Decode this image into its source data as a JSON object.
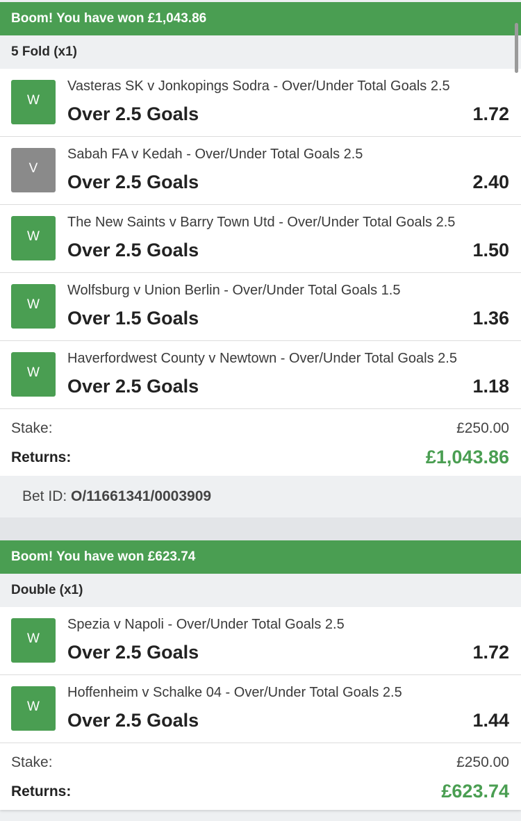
{
  "bets": [
    {
      "banner": "Boom! You have won £1,043.86",
      "type": "5 Fold (x1)",
      "legs": [
        {
          "result": "W",
          "market": "Vasteras SK v Jonkopings Sodra - Over/Under Total Goals 2.5",
          "selection": "Over 2.5 Goals",
          "odds": "1.72"
        },
        {
          "result": "V",
          "market": "Sabah FA v Kedah - Over/Under Total Goals 2.5",
          "selection": "Over 2.5 Goals",
          "odds": "2.40"
        },
        {
          "result": "W",
          "market": "The New Saints v Barry Town Utd - Over/Under Total Goals 2.5",
          "selection": "Over 2.5 Goals",
          "odds": "1.50"
        },
        {
          "result": "W",
          "market": "Wolfsburg v Union Berlin - Over/Under Total Goals 1.5",
          "selection": "Over 1.5 Goals",
          "odds": "1.36"
        },
        {
          "result": "W",
          "market": "Haverfordwest County v Newtown - Over/Under Total Goals 2.5",
          "selection": "Over 2.5 Goals",
          "odds": "1.18"
        }
      ],
      "stake_label": "Stake:",
      "stake": "£250.00",
      "returns_label": "Returns:",
      "returns": "£1,043.86",
      "bet_id_label": "Bet ID:",
      "bet_id": "O/11661341/0003909"
    },
    {
      "banner": "Boom! You have won £623.74",
      "type": "Double (x1)",
      "legs": [
        {
          "result": "W",
          "market": "Spezia v Napoli - Over/Under Total Goals 2.5",
          "selection": "Over 2.5 Goals",
          "odds": "1.72"
        },
        {
          "result": "W",
          "market": "Hoffenheim v Schalke 04 - Over/Under Total Goals 2.5",
          "selection": "Over 2.5 Goals",
          "odds": "1.44"
        }
      ],
      "stake_label": "Stake:",
      "stake": "£250.00",
      "returns_label": "Returns:",
      "returns": "£623.74"
    }
  ],
  "colors": {
    "win_green": "#4a9e52",
    "void_grey": "#8a8a8a",
    "background": "#eef0f2"
  }
}
